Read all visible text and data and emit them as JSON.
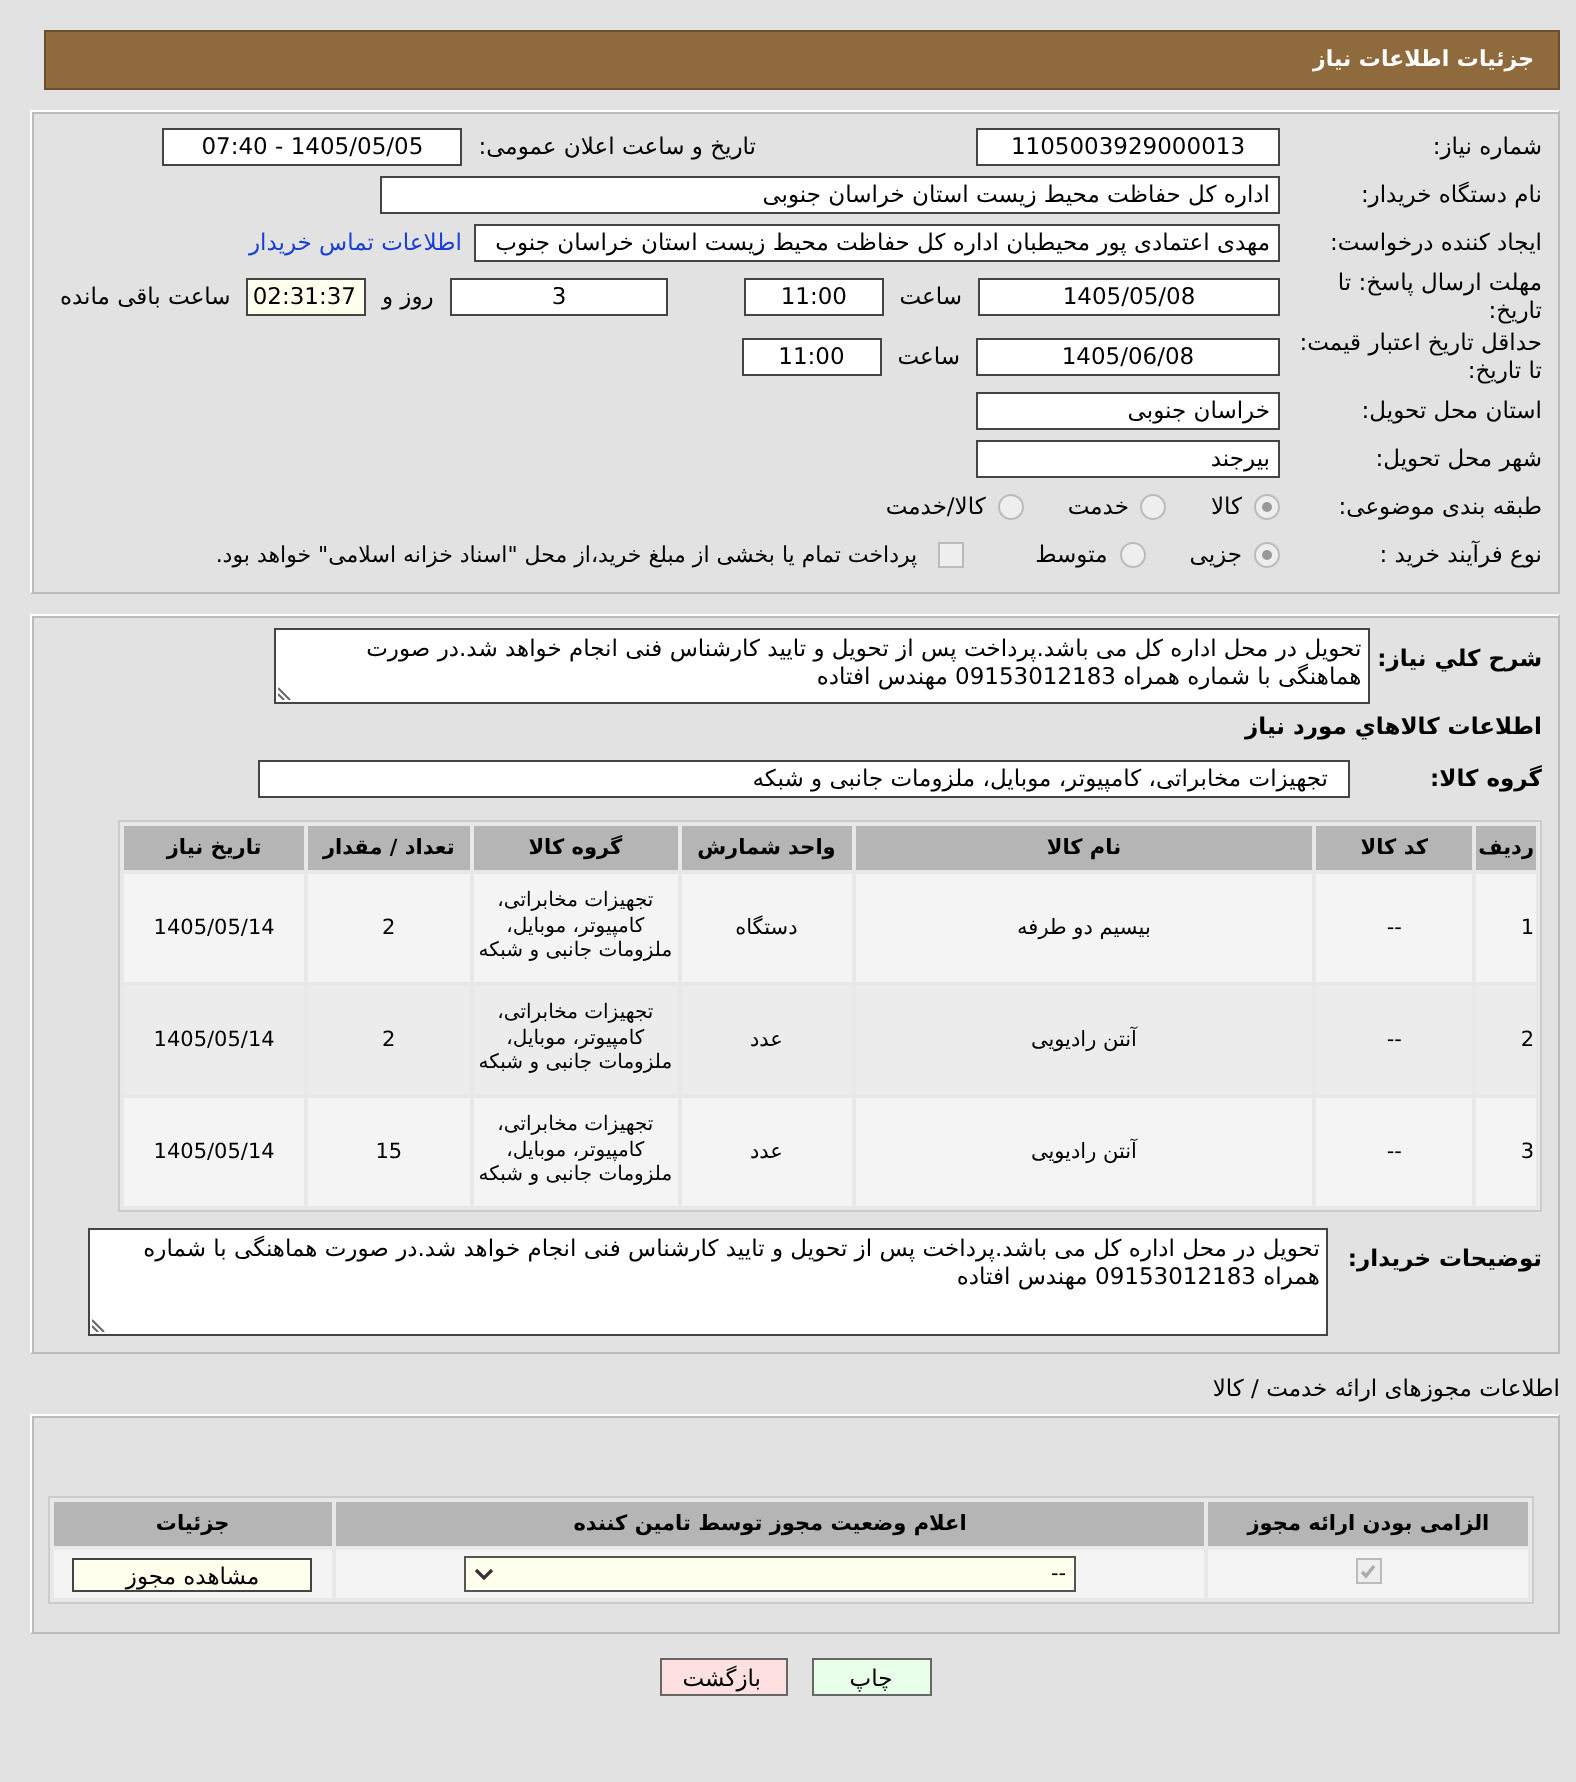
{
  "header": {
    "title": "جزئیات اطلاعات نیاز"
  },
  "need_info": {
    "need_number": {
      "label": "شماره نیاز:",
      "value": "1105003929000013"
    },
    "announce_datetime": {
      "label": "تاریخ و ساعت اعلان عمومی:",
      "value": "1405/05/05 - 07:40"
    },
    "buyer_org": {
      "label": "نام دستگاه خریدار:",
      "value": "اداره کل حفاظت محیط زیست استان خراسان جنوبی"
    },
    "requester": {
      "label": "ایجاد کننده درخواست:",
      "value": "مهدی اعتمادی پور محیطبان اداره کل حفاظت محیط زیست استان خراسان جنوب",
      "contact_link": "اطلاعات تماس خریدار"
    },
    "response_deadline": {
      "label": "مهلت ارسال پاسخ: تا تاریخ:",
      "date": "1405/05/08",
      "time_label": "ساعت",
      "time": "11:00",
      "days": "3",
      "days_label": "روز و",
      "remaining": "02:31:37",
      "remaining_label": "ساعت باقی مانده"
    },
    "price_validity": {
      "label": "حداقل تاریخ اعتبار قیمت: تا تاریخ:",
      "date": "1405/06/08",
      "time_label": "ساعت",
      "time": "11:00"
    },
    "delivery_province": {
      "label": "استان محل تحویل:",
      "value": "خراسان جنوبی"
    },
    "delivery_city": {
      "label": "شهر محل تحویل:",
      "value": "بیرجند"
    },
    "category": {
      "label": "طبقه بندی موضوعی:",
      "options": [
        {
          "label": "کالا",
          "selected": true
        },
        {
          "label": "خدمت",
          "selected": false
        },
        {
          "label": "کالا/خدمت",
          "selected": false
        }
      ]
    },
    "process_type": {
      "label": "نوع فرآیند خرید :",
      "options": [
        {
          "label": "جزیی",
          "selected": true
        },
        {
          "label": "متوسط",
          "selected": false
        }
      ],
      "treasury": {
        "label": "پرداخت تمام یا بخشی از مبلغ خرید،از محل \"اسناد خزانه اسلامی\" خواهد بود.",
        "checked": false
      }
    }
  },
  "goods": {
    "description": {
      "label": "شرح کلي نياز:",
      "value": "تحویل در محل اداره کل می باشد.پرداخت پس از تحویل و تایید کارشناس فنی انجام خواهد شد.در صورت هماهنگی با شماره همراه 09153012183 مهندس افتاده"
    },
    "section_title": "اطلاعات کالاهاي مورد نياز",
    "group": {
      "label": "گروه کالا:",
      "value": "تجهیزات مخابراتی، کامپیوتر، موبایل، ملزومات جانبی و شبکه"
    },
    "table": {
      "columns": [
        "ردیف",
        "کد کالا",
        "نام کالا",
        "واحد شمارش",
        "گروه کالا",
        "تعداد / مقدار",
        "تاریخ نیاز"
      ],
      "rows": [
        [
          "1",
          "--",
          "بیسیم دو طرفه",
          "دستگاه",
          "تجهیزات مخابراتی، کامپیوتر، موبایل، ملزومات جانبی و شبکه",
          "2",
          "1405/05/14"
        ],
        [
          "2",
          "--",
          "آنتن رادیویی",
          "عدد",
          "تجهیزات مخابراتی، کامپیوتر، موبایل، ملزومات جانبی و شبکه",
          "2",
          "1405/05/14"
        ],
        [
          "3",
          "--",
          "آنتن رادیویی",
          "عدد",
          "تجهیزات مخابراتی، کامپیوتر، موبایل، ملزومات جانبی و شبکه",
          "15",
          "1405/05/14"
        ]
      ]
    },
    "buyer_notes": {
      "label": "توضیحات خریدار:",
      "value": "تحویل در محل اداره کل می باشد.پرداخت پس از تحویل و تایید کارشناس فنی انجام خواهد شد.در صورت هماهنگی با شماره همراه 09153012183 مهندس افتاده"
    }
  },
  "licenses": {
    "title": "اطلاعات مجوزهای ارائه خدمت / کالا",
    "columns": [
      "الزامی بودن ارائه مجوز",
      "اعلام وضعیت مجوز توسط تامین کننده",
      "جزئیات"
    ],
    "rows": [
      {
        "required": true,
        "status": "--",
        "action": "مشاهده مجوز"
      }
    ]
  },
  "buttons": [
    {
      "kind": "print",
      "label": "چاپ"
    },
    {
      "kind": "back",
      "label": "بازگشت"
    }
  ]
}
